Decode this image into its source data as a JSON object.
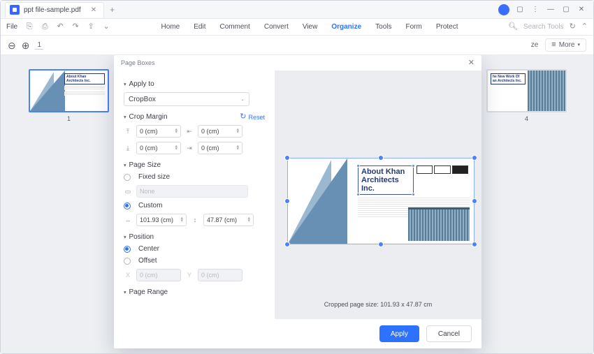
{
  "titlebar": {
    "filename": "ppt file-sample.pdf",
    "add_tab": "+"
  },
  "menubar": {
    "file": "File",
    "items": [
      "Home",
      "Edit",
      "Comment",
      "Convert",
      "View",
      "Organize",
      "Tools",
      "Form",
      "Protect"
    ],
    "active": "Organize",
    "search_placeholder": "Search Tools"
  },
  "toolbar": {
    "page_input": "1",
    "size_label": "ze",
    "more": "More"
  },
  "thumbs": {
    "first": {
      "num": "1",
      "title": "About Khan Architects Inc."
    },
    "last": {
      "num": "4",
      "title": "he New Work Of an Architects Inc."
    }
  },
  "dialog": {
    "title": "Page Boxes",
    "apply_to": {
      "label": "Apply to",
      "value": "CropBox"
    },
    "crop_margin": {
      "label": "Crop Margin",
      "reset": "Reset",
      "top": "0 (cm)",
      "bottom": "0 (cm)",
      "left": "0 (cm)",
      "right": "0 (cm)"
    },
    "page_size": {
      "label": "Page Size",
      "fixed": "Fixed size",
      "name_placeholder": "None",
      "custom": "Custom",
      "width": "101.93 (cm)",
      "height": "47.87 (cm)"
    },
    "position": {
      "label": "Position",
      "center": "Center",
      "offset": "Offset",
      "x_ph": "0 (cm)",
      "y_ph": "0 (cm)"
    },
    "page_range": {
      "label": "Page Range"
    },
    "preview": {
      "title_line1": "About Khan",
      "title_line2": "Architects Inc.",
      "cropped_label": "Cropped page size: 101.93 x 47.87 cm"
    },
    "buttons": {
      "apply": "Apply",
      "cancel": "Cancel"
    }
  }
}
